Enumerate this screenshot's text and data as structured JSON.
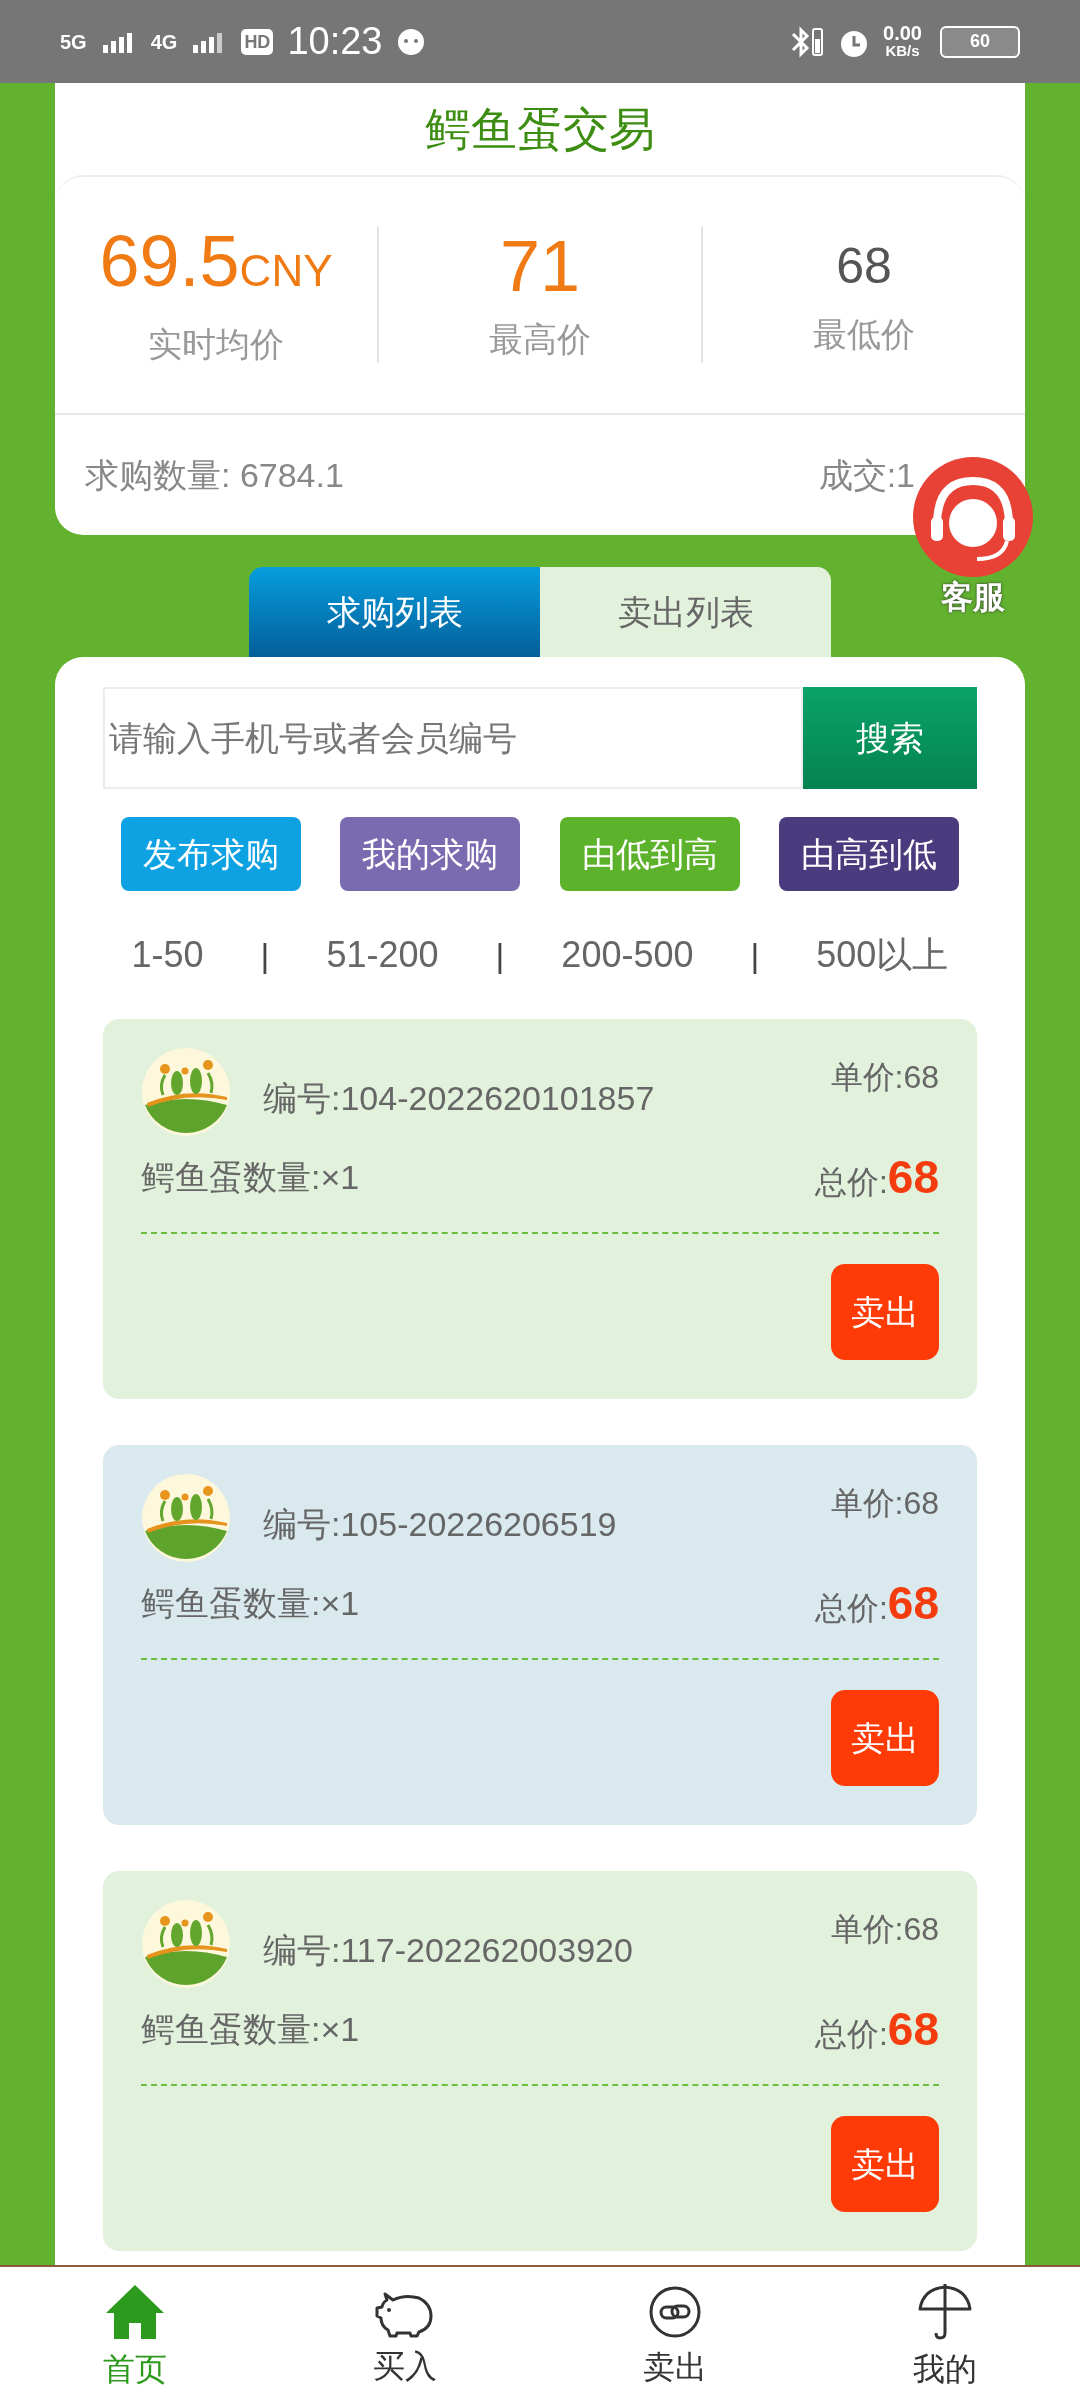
{
  "status_bar": {
    "network_1": "5G",
    "network_2": "4G",
    "hd_badge": "HD",
    "time": "10:23",
    "speed": "0.00",
    "speed_unit": "KB/s",
    "battery": "60"
  },
  "header": {
    "title": "鳄鱼蛋交易"
  },
  "stats": [
    {
      "value": "69.5",
      "unit": "CNY",
      "label": "实时均价",
      "kind": "highlight"
    },
    {
      "value": "71",
      "label": "最高价",
      "kind": "highlight"
    },
    {
      "value": "68",
      "label": "最低价",
      "kind": "plain"
    }
  ],
  "summary": {
    "demand": "求购数量: 6784.1",
    "deals": "成交:1"
  },
  "support": {
    "label": "客服"
  },
  "tabs": [
    {
      "label": "求购列表",
      "selected": true
    },
    {
      "label": "卖出列表",
      "selected": false
    }
  ],
  "search": {
    "placeholder": "请输入手机号或者会员编号",
    "button": "搜索"
  },
  "actions": [
    {
      "label": "发布求购",
      "color": "#0ea2e2"
    },
    {
      "label": "我的求购",
      "color": "#7a6bb0"
    },
    {
      "label": "由低到高",
      "color": "#5cb22a"
    },
    {
      "label": "由高到低",
      "color": "#4a3b7e"
    }
  ],
  "range_filters": [
    {
      "kind": "range",
      "label": "1-50"
    },
    {
      "kind": "separator",
      "label": "|"
    },
    {
      "kind": "range",
      "label": "51-200"
    },
    {
      "kind": "separator",
      "label": "|"
    },
    {
      "kind": "range",
      "label": "200-500"
    },
    {
      "kind": "separator",
      "label": "|"
    },
    {
      "kind": "range",
      "label": "500以上"
    }
  ],
  "orders": [
    {
      "id": "编号:104-2022620101857",
      "unit_price": "单价:68",
      "quantity": "鳄鱼蛋数量:×1",
      "total_label": "总价:",
      "total": "68",
      "button": "卖出",
      "color": "#e1f1dc"
    },
    {
      "id": "编号:105-20226206519",
      "unit_price": "单价:68",
      "quantity": "鳄鱼蛋数量:×1",
      "total_label": "总价:",
      "total": "68",
      "button": "卖出",
      "color": "#d9e9ee"
    },
    {
      "id": "编号:117-202262003920",
      "unit_price": "单价:68",
      "quantity": "鳄鱼蛋数量:×1",
      "total_label": "总价:",
      "total": "68",
      "button": "卖出",
      "color": "#e1f1dc"
    }
  ],
  "bottom_nav": [
    {
      "label": "首页",
      "kind": "home",
      "selected": true
    },
    {
      "label": "买入",
      "kind": "piggy",
      "selected": false
    },
    {
      "label": "卖出",
      "kind": "link",
      "selected": false
    },
    {
      "label": "我的",
      "kind": "umbrella",
      "selected": false
    }
  ]
}
